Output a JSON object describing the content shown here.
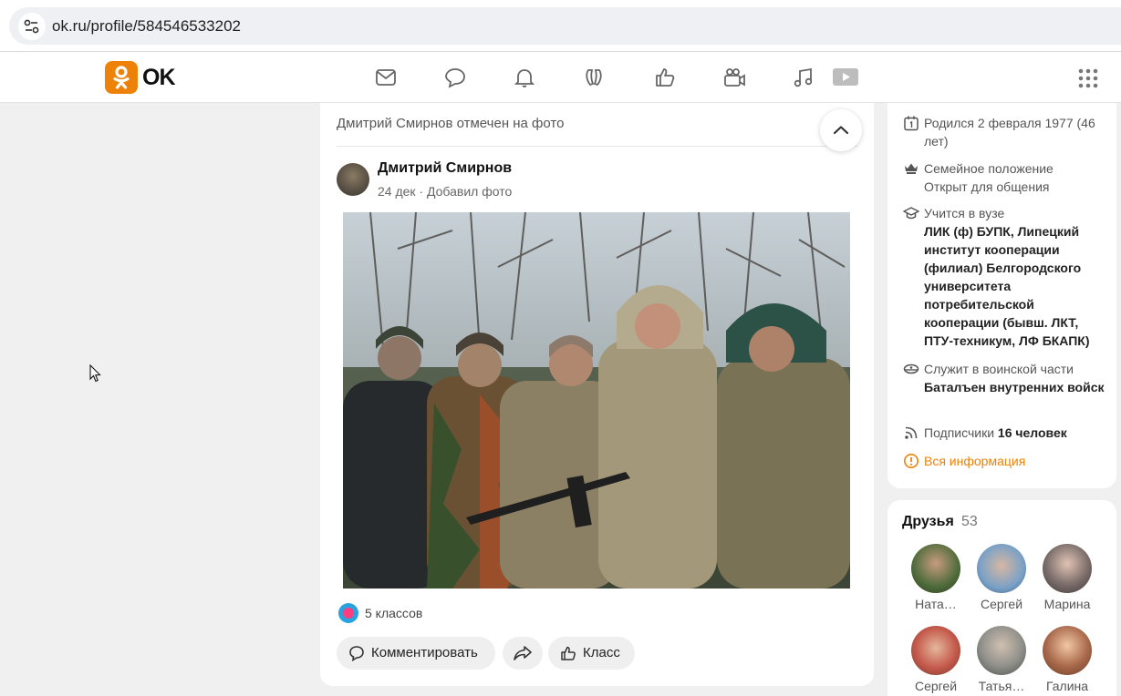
{
  "browser": {
    "url": "ok.ru/profile/584546533202",
    "site_info_icon": "tune-icon"
  },
  "header": {
    "logo_text": "OK",
    "brand_color": "#ee8208",
    "nav_icons": [
      "mail-icon",
      "discussions-icon",
      "notifications-icon",
      "guests-icon",
      "likes-icon",
      "video-icon",
      "music-icon",
      "video-showcase-icon"
    ],
    "apps_icon": "apps-grid-icon"
  },
  "post": {
    "tag_line": "Дмитрий Смирнов отмечен на фото",
    "author": "Дмитрий Смирнов",
    "meta": "24 дек · Добавил фото",
    "likes_text": "5 классов",
    "actions": {
      "comment": "Комментировать",
      "like": "Класс"
    }
  },
  "profile_info": {
    "birth": "Родился 2 февраля 1977 (46 лет)",
    "family_label": "Семейное положение",
    "family_value": "Открыт для общения",
    "study_label": "Учится в вузе",
    "study_value": "ЛИК (ф) БУПК, Липецкий институт кооперации (филиал) Белгородского университета потребительской кооперации (бывш. ЛКТ, ПТУ-техникум, ЛФ БКАПК)",
    "military_label": "Служит в воинской части",
    "military_value": "Баталъен внутренних войск",
    "subscribers_label": "Подписчики",
    "subscribers_value": "16 человек",
    "all_info": "Вся информация"
  },
  "friends": {
    "title": "Друзья",
    "count": "53",
    "items": [
      {
        "name": "Ната…"
      },
      {
        "name": "Сергей"
      },
      {
        "name": "Марина"
      },
      {
        "name": "Сергей"
      },
      {
        "name": "Татья…"
      },
      {
        "name": "Галина"
      }
    ]
  }
}
